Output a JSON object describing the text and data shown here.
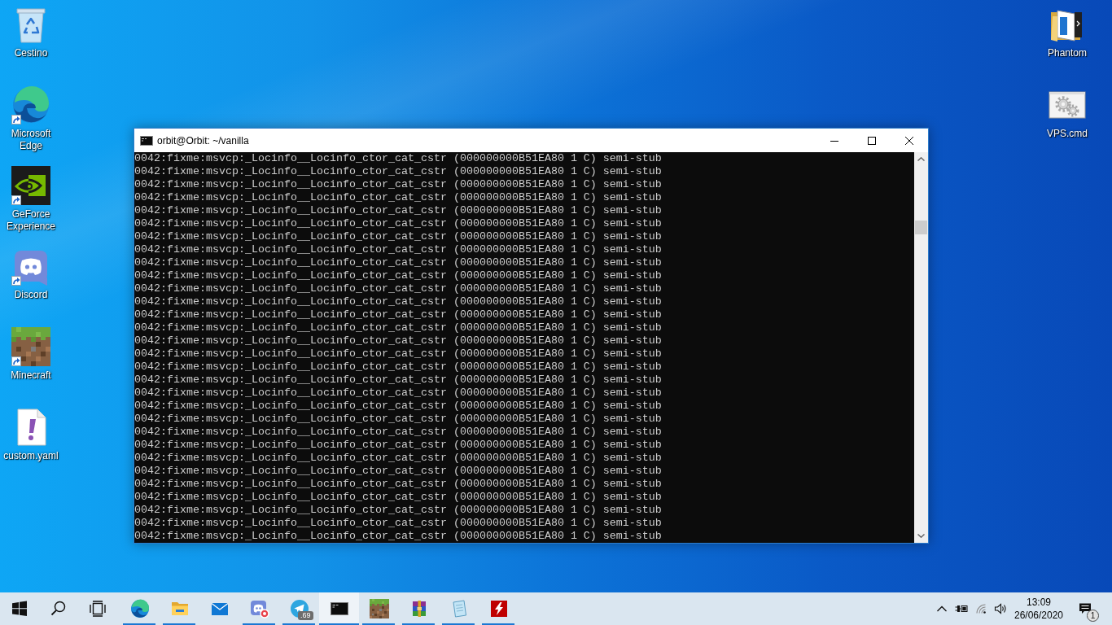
{
  "desktop": {
    "left_icons": [
      {
        "label": "Cestino",
        "shortcut": false
      },
      {
        "label": "Microsoft Edge",
        "shortcut": true
      },
      {
        "label": "GeForce Experience",
        "shortcut": true
      },
      {
        "label": "Discord",
        "shortcut": true
      },
      {
        "label": "Minecraft",
        "shortcut": true
      },
      {
        "label": "custom.yaml",
        "shortcut": false
      }
    ],
    "right_icons": [
      {
        "label": "Phantom",
        "shortcut": false
      },
      {
        "label": "VPS.cmd",
        "shortcut": false
      }
    ]
  },
  "window": {
    "title": "orbit@Orbit: ~/vanilla",
    "lines": [
      "0042:fixme:msvcp:_Locinfo__Locinfo_ctor_cat_cstr (000000000B51EA80 1 C) semi-stub",
      "0042:fixme:msvcp:_Locinfo__Locinfo_ctor_cat_cstr (000000000B51EA80 1 C) semi-stub",
      "0042:fixme:msvcp:_Locinfo__Locinfo_ctor_cat_cstr (000000000B51EA80 1 C) semi-stub",
      "0042:fixme:msvcp:_Locinfo__Locinfo_ctor_cat_cstr (000000000B51EA80 1 C) semi-stub",
      "0042:fixme:msvcp:_Locinfo__Locinfo_ctor_cat_cstr (000000000B51EA80 1 C) semi-stub",
      "0042:fixme:msvcp:_Locinfo__Locinfo_ctor_cat_cstr (000000000B51EA80 1 C) semi-stub",
      "0042:fixme:msvcp:_Locinfo__Locinfo_ctor_cat_cstr (000000000B51EA80 1 C) semi-stub",
      "0042:fixme:msvcp:_Locinfo__Locinfo_ctor_cat_cstr (000000000B51EA80 1 C) semi-stub",
      "0042:fixme:msvcp:_Locinfo__Locinfo_ctor_cat_cstr (000000000B51EA80 1 C) semi-stub",
      "0042:fixme:msvcp:_Locinfo__Locinfo_ctor_cat_cstr (000000000B51EA80 1 C) semi-stub",
      "0042:fixme:msvcp:_Locinfo__Locinfo_ctor_cat_cstr (000000000B51EA80 1 C) semi-stub",
      "0042:fixme:msvcp:_Locinfo__Locinfo_ctor_cat_cstr (000000000B51EA80 1 C) semi-stub",
      "0042:fixme:msvcp:_Locinfo__Locinfo_ctor_cat_cstr (000000000B51EA80 1 C) semi-stub",
      "0042:fixme:msvcp:_Locinfo__Locinfo_ctor_cat_cstr (000000000B51EA80 1 C) semi-stub",
      "0042:fixme:msvcp:_Locinfo__Locinfo_ctor_cat_cstr (000000000B51EA80 1 C) semi-stub",
      "0042:fixme:msvcp:_Locinfo__Locinfo_ctor_cat_cstr (000000000B51EA80 1 C) semi-stub",
      "0042:fixme:msvcp:_Locinfo__Locinfo_ctor_cat_cstr (000000000B51EA80 1 C) semi-stub",
      "0042:fixme:msvcp:_Locinfo__Locinfo_ctor_cat_cstr (000000000B51EA80 1 C) semi-stub",
      "0042:fixme:msvcp:_Locinfo__Locinfo_ctor_cat_cstr (000000000B51EA80 1 C) semi-stub",
      "0042:fixme:msvcp:_Locinfo__Locinfo_ctor_cat_cstr (000000000B51EA80 1 C) semi-stub",
      "0042:fixme:msvcp:_Locinfo__Locinfo_ctor_cat_cstr (000000000B51EA80 1 C) semi-stub",
      "0042:fixme:msvcp:_Locinfo__Locinfo_ctor_cat_cstr (000000000B51EA80 1 C) semi-stub",
      "0042:fixme:msvcp:_Locinfo__Locinfo_ctor_cat_cstr (000000000B51EA80 1 C) semi-stub",
      "0042:fixme:msvcp:_Locinfo__Locinfo_ctor_cat_cstr (000000000B51EA80 1 C) semi-stub",
      "0042:fixme:msvcp:_Locinfo__Locinfo_ctor_cat_cstr (000000000B51EA80 1 C) semi-stub",
      "0042:fixme:msvcp:_Locinfo__Locinfo_ctor_cat_cstr (000000000B51EA80 1 C) semi-stub",
      "0042:fixme:msvcp:_Locinfo__Locinfo_ctor_cat_cstr (000000000B51EA80 1 C) semi-stub",
      "0042:fixme:msvcp:_Locinfo__Locinfo_ctor_cat_cstr (000000000B51EA80 1 C) semi-stub",
      "0042:fixme:msvcp:_Locinfo__Locinfo_ctor_cat_cstr (000000000B51EA80 1 C) semi-stub",
      "0042:fixme:msvcp:_Locinfo__Locinfo_ctor_cat_cstr (000000000B51EA80 1 C) semi-stub"
    ]
  },
  "taskbar": {
    "apps": [
      {
        "running": true,
        "selected": false
      },
      {
        "running": true,
        "selected": false
      },
      {
        "running": false,
        "selected": false
      },
      {
        "running": true,
        "selected": false
      },
      {
        "running": true,
        "selected": false,
        "badge": ".69"
      },
      {
        "running": true,
        "selected": true
      },
      {
        "running": true,
        "selected": false
      },
      {
        "running": true,
        "selected": false
      },
      {
        "running": true,
        "selected": false
      },
      {
        "running": true,
        "selected": false
      }
    ],
    "clock": {
      "time": "13:09",
      "date": "26/06/2020"
    },
    "notification_count": "1"
  }
}
